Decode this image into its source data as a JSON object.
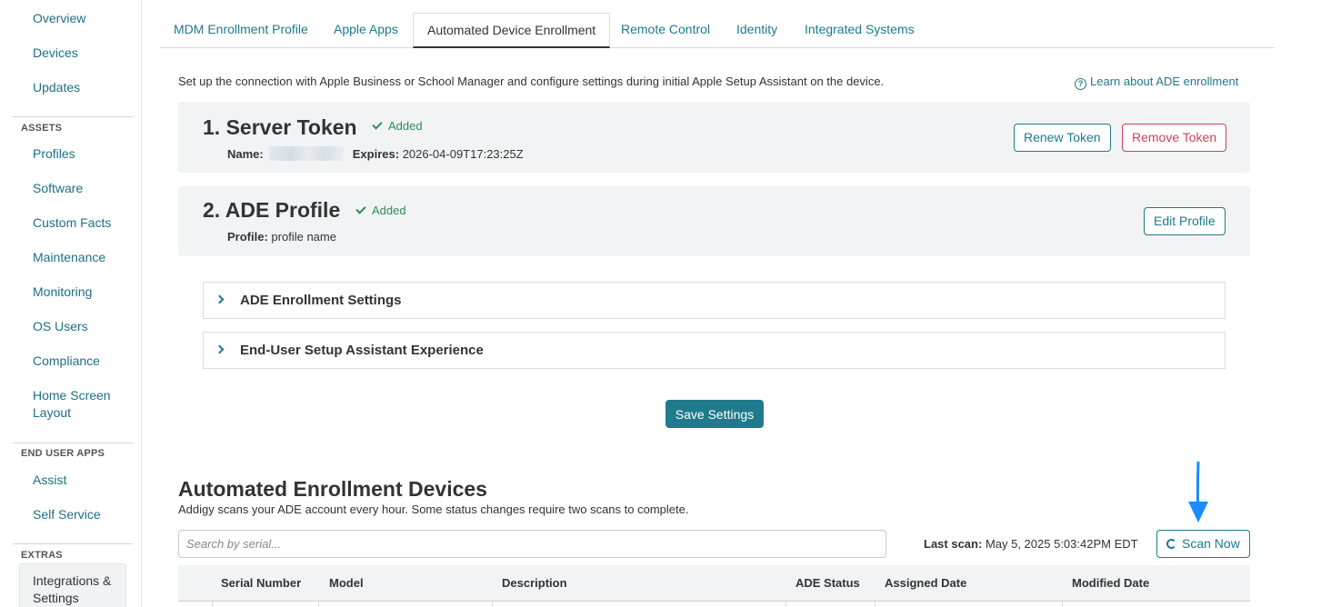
{
  "sidebar": {
    "top_items": [
      "Overview",
      "Devices",
      "Updates"
    ],
    "assets_heading": "ASSETS",
    "assets_items": [
      "Profiles",
      "Software",
      "Custom Facts",
      "Maintenance",
      "Monitoring",
      "OS Users",
      "Compliance",
      "Home Screen Layout"
    ],
    "end_user_heading": "END USER APPS",
    "end_user_items": [
      "Assist",
      "Self Service"
    ],
    "extras_heading": "EXTRAS",
    "extras_active": "Integrations & Settings"
  },
  "tabs": [
    {
      "label": "MDM Enrollment Profile",
      "active": false
    },
    {
      "label": "Apple Apps",
      "active": false
    },
    {
      "label": "Automated Device Enrollment",
      "active": true
    },
    {
      "label": "Remote Control",
      "active": false
    },
    {
      "label": "Identity",
      "active": false
    },
    {
      "label": "Integrated Systems",
      "active": false
    }
  ],
  "intro": "Set up the connection with Apple Business or School Manager and configure settings during initial Apple Setup Assistant on the device.",
  "learn_link": "Learn about ADE enrollment",
  "server_token": {
    "title": "1. Server Token",
    "status": "Added",
    "name_label": "Name:",
    "expires_label": "Expires:",
    "expires_value": "2026-04-09T17:23:25Z",
    "renew_label": "Renew Token",
    "remove_label": "Remove Token"
  },
  "ade_profile": {
    "title": "2. ADE Profile",
    "status": "Added",
    "profile_label": "Profile:",
    "profile_value": "profile name",
    "edit_label": "Edit Profile"
  },
  "accordions": [
    "ADE Enrollment Settings",
    "End-User Setup Assistant Experience"
  ],
  "save_label": "Save Settings",
  "devices": {
    "title": "Automated Enrollment Devices",
    "subtitle": "Addigy scans your ADE account every hour. Some status changes require two scans to complete.",
    "search_placeholder": "Search by serial...",
    "last_scan_label": "Last scan:",
    "last_scan_value": "May 5, 2025 5:03:42PM EDT",
    "scan_label": "Scan Now",
    "columns": [
      "Serial Number",
      "Model",
      "Description",
      "ADE Status",
      "Assigned Date",
      "Modified Date"
    ]
  },
  "colors": {
    "accent": "#1f7a8c",
    "danger": "#d43f5a",
    "success": "#2e8b57",
    "arrow": "#1a8cff"
  }
}
